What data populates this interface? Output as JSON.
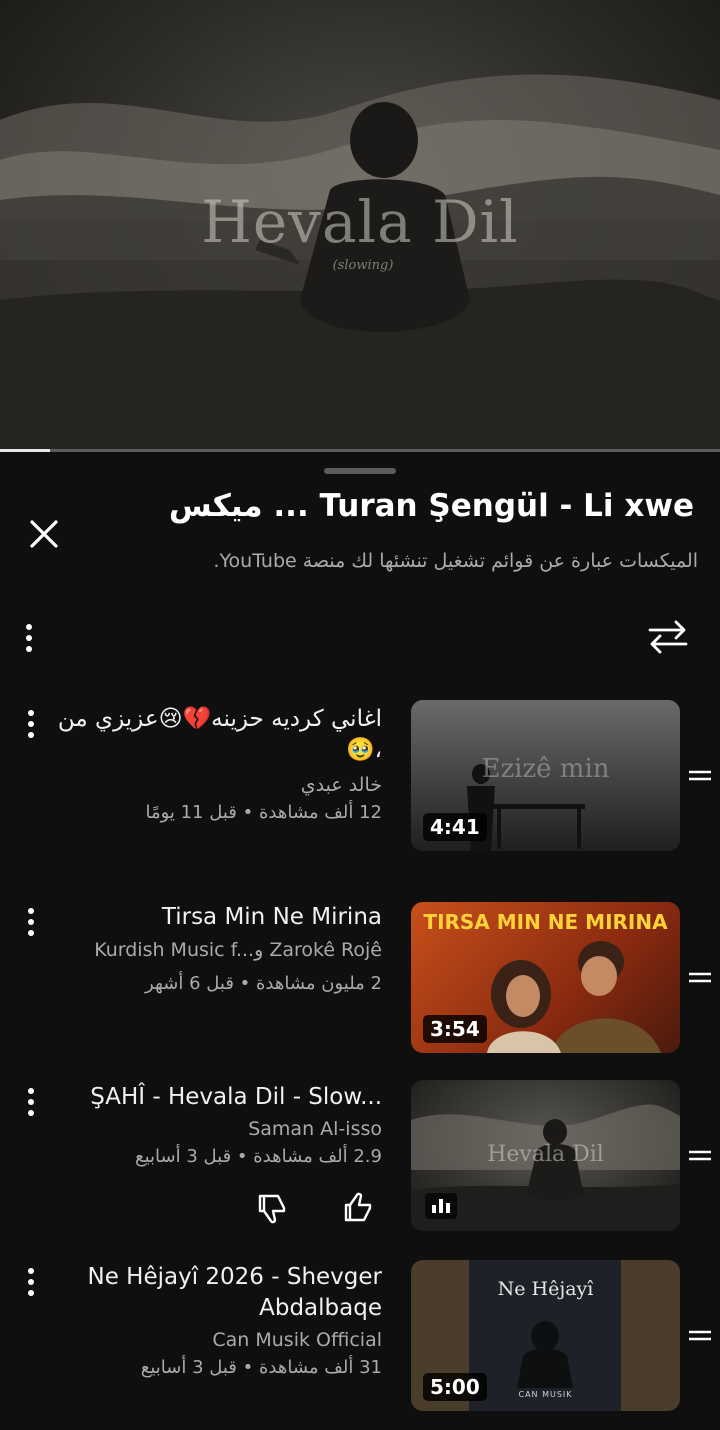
{
  "player": {
    "video_title": "Hevala Dil",
    "video_subtitle": "(slowing)",
    "progress": 0.07
  },
  "queue": {
    "title": "Turan Şengül - Li xwe ... ميكس",
    "subtitle": "الميكسات عبارة عن قوائم تشغيل تنشئها لك منصة YouTube."
  },
  "items": [
    {
      "title": "اغاني كرديه حزينه💔😢عزيزي من ،🥹",
      "channel": "خالد عبدي",
      "meta": "12 ألف مشاهدة • قبل 11 يومًا",
      "duration": "4:41",
      "thumb_text": "Ezizê min"
    },
    {
      "title": "Tirsa Min Ne Mirina",
      "channel": "Kurdish Music f...و Zarokê Rojê",
      "meta": "2 مليون مشاهدة • قبل 6 أشهر",
      "duration": "3:54",
      "thumb_text": "TIRSA MIN NE MIRINA"
    },
    {
      "title": "ŞAHÎ - Hevala Dil - Slow...",
      "channel": "Saman Al-isso",
      "meta": "2.9 ألف مشاهدة • قبل 3 أسابيع",
      "duration": "",
      "thumb_text": "Hevala Dil",
      "now_playing": true
    },
    {
      "title": "Ne Hêjayî 2026 - Shevger Abdalbaqe",
      "channel": "Can Musik Official",
      "meta": "31 ألف مشاهدة • قبل 3 أسابيع",
      "duration": "5:00",
      "thumb_text": "Ne Hêjayî",
      "thumb_sub": "CAN MUSIK"
    }
  ],
  "icons": {
    "close": "close-icon",
    "more": "more-vert-icon",
    "loop": "loop-icon",
    "drag": "drag-handle-icon",
    "like": "thumb-up-icon",
    "dislike": "thumb-down-icon",
    "playing": "now-playing-bars-icon"
  },
  "colors": {
    "background": "#0f0f0f",
    "text_primary": "#f1f1f1",
    "text_secondary": "#aaaaaa"
  }
}
